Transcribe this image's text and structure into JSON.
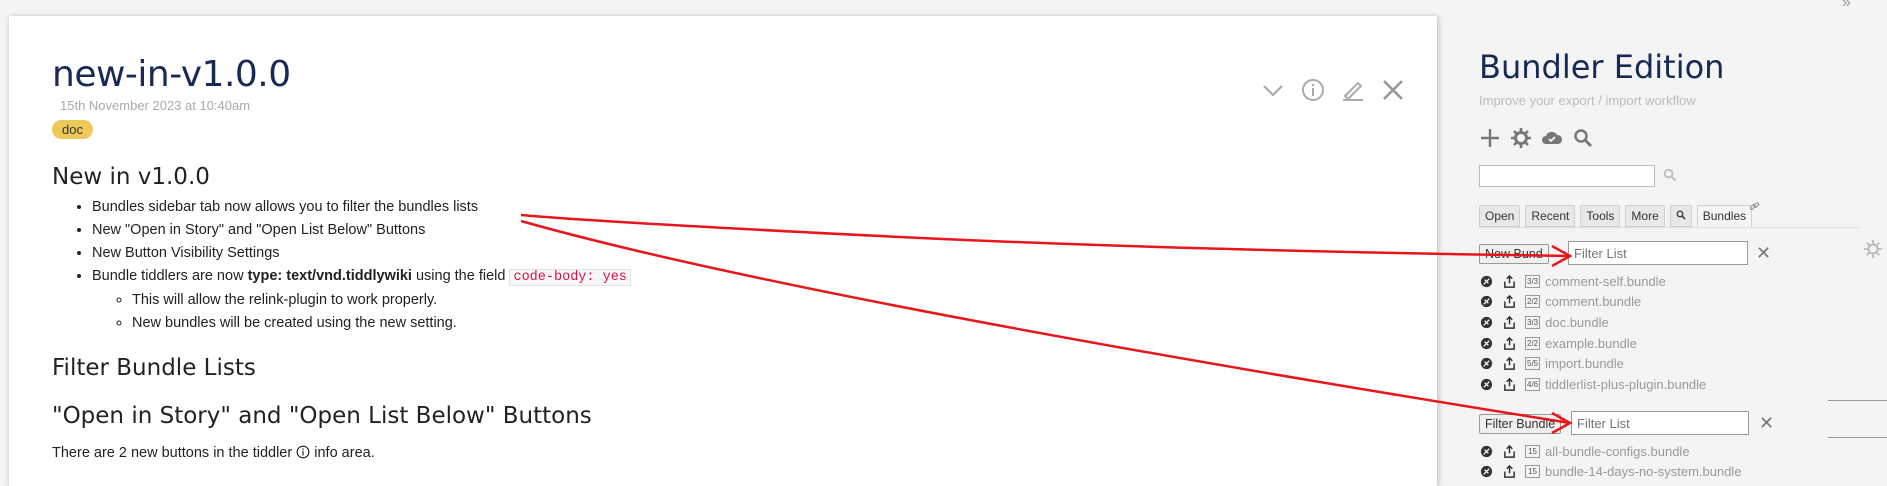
{
  "tiddler": {
    "title": "new-in-v1.0.0",
    "date": "15th November 2023 at 10:40am",
    "tag": "doc",
    "h_new": "New in v1.0.0",
    "bullets": {
      "b1": "Bundles sidebar tab now allows you to filter the bundles lists",
      "b2": "New \"Open in Story\" and \"Open List Below\" Buttons",
      "b3": "New Button Visibility Settings",
      "b4_pre": "Bundle tiddlers are now ",
      "b4_bold": "type: text/vnd.tiddlywiki",
      "b4_mid": " using the field ",
      "b4_code": "code-body: yes",
      "sub1": "This will allow the relink-plugin to work properly.",
      "sub2": "New bundles will be created using the new setting."
    },
    "h_filter": "Filter Bundle Lists",
    "h_open": "\"Open in Story\" and \"Open List Below\" Buttons",
    "p_pre": "There are 2 new buttons in the tiddler ",
    "p_post": " info area.",
    "controls": [
      "chevron-down-icon",
      "info-icon",
      "edit-icon",
      "close-icon"
    ]
  },
  "sidebar": {
    "title": "Bundler Edition",
    "subtitle": "Improve your export / import workflow",
    "icons": [
      "plus-icon",
      "gear-icon",
      "cloud-icon",
      "search-icon"
    ],
    "search_value": "",
    "tabs": {
      "open": "Open",
      "recent": "Recent",
      "tools": "Tools",
      "more": "More",
      "bundles": "Bundles"
    },
    "new_bundle_button": "New Bund",
    "filter_bundle_button": "Filter Bundle",
    "filter_placeholder": "Filter List",
    "list1": [
      {
        "count": "3/3",
        "name": "comment-self.bundle"
      },
      {
        "count": "2/2",
        "name": "comment.bundle"
      },
      {
        "count": "3/3",
        "name": "doc.bundle"
      },
      {
        "count": "2/2",
        "name": "example.bundle"
      },
      {
        "count": "5/5",
        "name": "import.bundle"
      },
      {
        "count": "4/6",
        "name": "tiddlerlist-plus-plugin.bundle"
      }
    ],
    "list2": [
      {
        "count": "15",
        "name": "all-bundle-configs.bundle"
      },
      {
        "count": "15",
        "name": "bundle-14-days-no-system.bundle"
      }
    ]
  },
  "colors": {
    "title": "#182955",
    "tag": "#ecc958",
    "annotation_arrow": "#e8151b",
    "code": "#dd1144"
  }
}
